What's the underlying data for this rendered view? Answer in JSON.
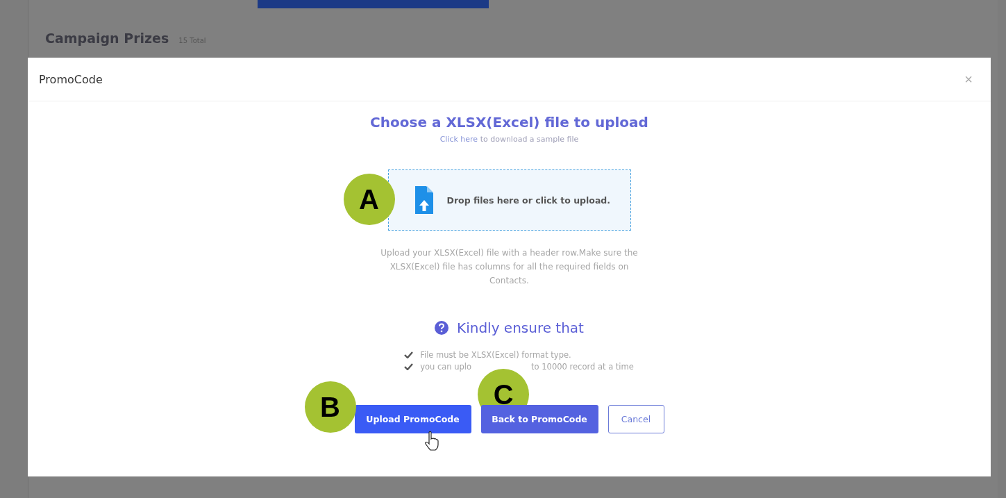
{
  "page": {
    "title": "Campaign Prizes",
    "count": "15 Total"
  },
  "modal": {
    "title": "PromoCode",
    "close": "×",
    "heading": "Choose a XLSX(Excel) file to upload",
    "sample": {
      "link": "Click here",
      "rest": " to download a sample file"
    },
    "dropzone": {
      "text": "Drop files here or click to upload.",
      "marker": "A"
    },
    "help": "Upload your XLSX(Excel) file with a header row.Make sure the XLSX(Excel) file has columns for all the required fields on Contacts.",
    "ensure_title": "Kindly ensure that",
    "rules": [
      {
        "before": "File must be XLSX(Excel) format type."
      },
      {
        "before": "you can uplo",
        "after": "to 10000 record at a time",
        "marker": "C"
      }
    ],
    "buttons": [
      {
        "label": "Upload PromoCode",
        "kind": "primary",
        "marker": "B"
      },
      {
        "label": "Back to PromoCode",
        "kind": "secondary"
      },
      {
        "label": "Cancel",
        "kind": "outline"
      }
    ]
  }
}
